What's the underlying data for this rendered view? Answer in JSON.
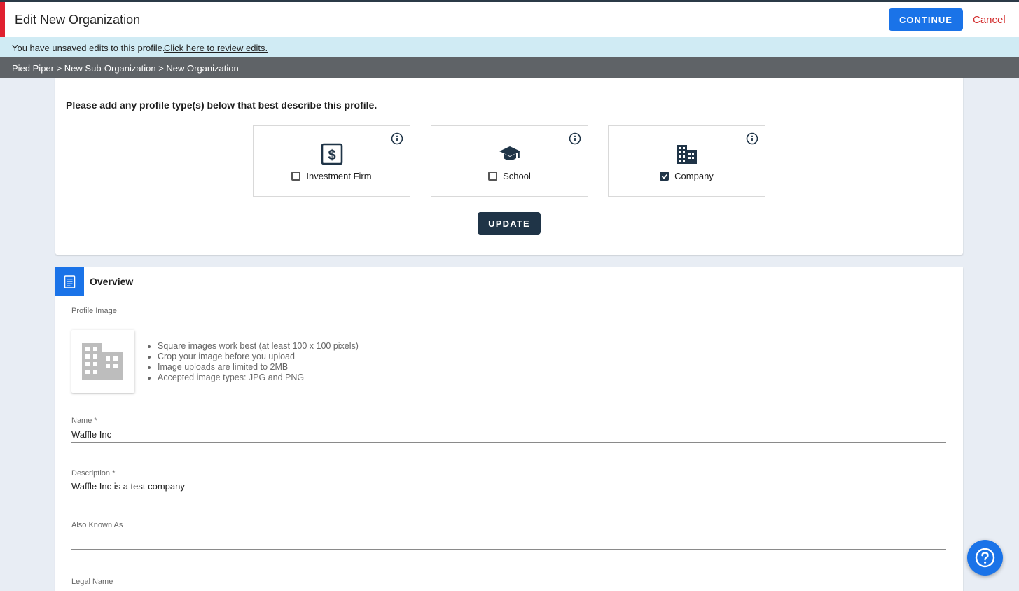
{
  "header": {
    "title": "Edit New Organization",
    "continue_label": "CONTINUE",
    "cancel_label": "Cancel"
  },
  "banner": {
    "message": "You have unsaved edits to this profile.",
    "link": "Click here to review edits."
  },
  "breadcrumb": "Pied Piper > New Sub-Organization > New Organization",
  "profile_types": {
    "prompt": "Please add any profile type(s) below that best describe this profile.",
    "items": [
      {
        "label": "Investment Firm",
        "icon": "dollar-sign-icon",
        "checked": false
      },
      {
        "label": "School",
        "icon": "graduation-cap-icon",
        "checked": false
      },
      {
        "label": "Company",
        "icon": "building-icon",
        "checked": true
      }
    ],
    "update_label": "UPDATE"
  },
  "overview": {
    "title": "Overview",
    "profile_image_label": "Profile Image",
    "tips": [
      "Square images work best (at least 100 x 100 pixels)",
      "Crop your image before you upload",
      "Image uploads are limited to 2MB",
      "Accepted image types: JPG and PNG"
    ],
    "fields": {
      "name_label": "Name *",
      "name_value": "Waffle Inc",
      "description_label": "Description *",
      "description_value": "Waffle Inc is a test company",
      "aka_label": "Also Known As",
      "aka_value": "",
      "legal_label": "Legal Name"
    }
  },
  "colors": {
    "primary": "#1a73e8",
    "dark": "#1f3447",
    "danger": "#d32f2f",
    "banner": "#d0ebf4",
    "breadcrumb_bg": "#5f6367"
  }
}
